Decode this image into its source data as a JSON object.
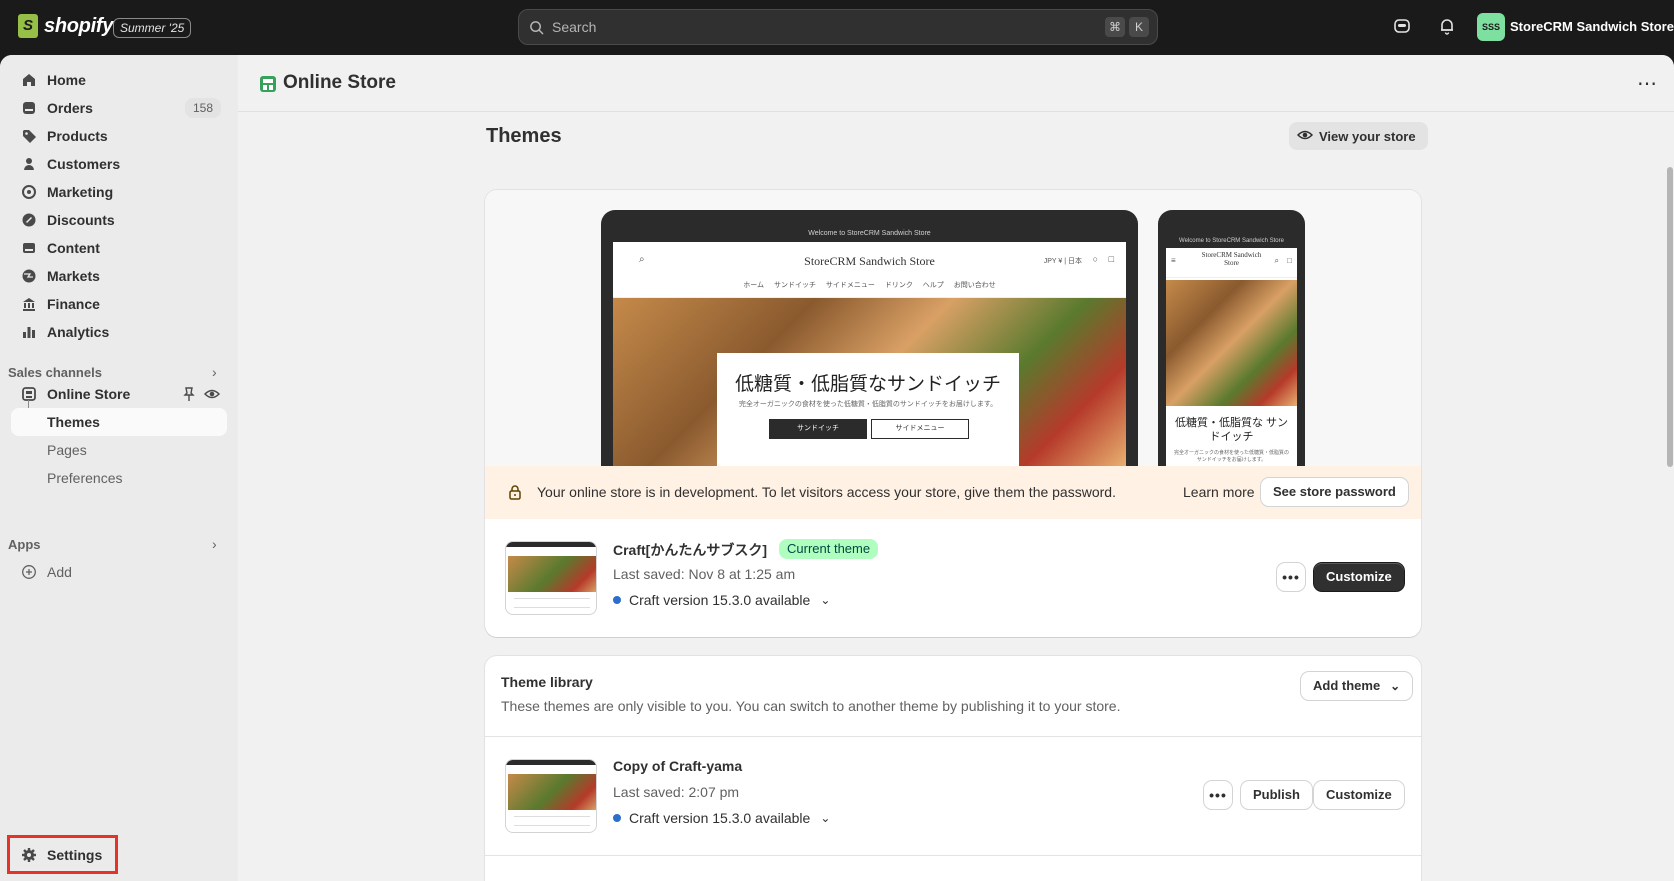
{
  "topbar": {
    "logo_text": "shopify",
    "edition_badge": "Summer '25",
    "search_placeholder": "Search",
    "shortcut_cmd": "⌘",
    "shortcut_key": "K",
    "store_initials": "SSS",
    "store_name": "StoreCRM Sandwich Store"
  },
  "sidebar": {
    "items": [
      {
        "label": "Home",
        "icon": "home-icon"
      },
      {
        "label": "Orders",
        "icon": "orders-icon",
        "count": "158"
      },
      {
        "label": "Products",
        "icon": "tag-icon"
      },
      {
        "label": "Customers",
        "icon": "person-icon"
      },
      {
        "label": "Marketing",
        "icon": "target-icon"
      },
      {
        "label": "Discounts",
        "icon": "discount-icon"
      },
      {
        "label": "Content",
        "icon": "content-icon"
      },
      {
        "label": "Markets",
        "icon": "globe-icon"
      },
      {
        "label": "Finance",
        "icon": "bank-icon"
      },
      {
        "label": "Analytics",
        "icon": "bar-chart-icon"
      }
    ],
    "sales_channels_label": "Sales channels",
    "online_store_label": "Online Store",
    "sub_items": [
      "Themes",
      "Pages",
      "Preferences"
    ],
    "apps_label": "Apps",
    "add_label": "Add",
    "settings_label": "Settings"
  },
  "page": {
    "title": "Online Store",
    "section_title": "Themes",
    "view_store_label": "View your store"
  },
  "preview": {
    "announcement": "Welcome to StoreCRM Sandwich Store",
    "store_title": "StoreCRM Sandwich Store",
    "currency": "JPY ¥ | 日本",
    "menu": "ホーム サンドイッチ サイドメニュー ドリンク ヘルプ お問い合わせ",
    "hero_title": "低糖質・低脂質なサンドイッチ",
    "hero_sub": "完全オーガニックの食材を使った低糖質・低脂質のサンドイッチをお届けします。",
    "hero_btn_primary": "サンドイッチ",
    "hero_btn_secondary": "サイドメニュー",
    "phone_store_title": "StoreCRM Sandwich Store",
    "phone_hero_title": "低糖質・低脂質な サンドイッチ",
    "phone_hero_sub": "完全オーガニックの食材を使った低糖質・低脂質のサンドイッチをお届けします。"
  },
  "dev_banner": {
    "text": "Your online store is in development. To let visitors access your store, give them the password.",
    "learn_more": "Learn more",
    "button": "See store password"
  },
  "current_theme": {
    "name": "Craft[かんたんサブスク]",
    "badge": "Current theme",
    "last_saved": "Last saved: Nov 8 at 1:25 am",
    "version": "Craft version 15.3.0 available",
    "customize_label": "Customize",
    "more_label": "•••"
  },
  "library": {
    "title": "Theme library",
    "description": "These themes are only visible to you. You can switch to another theme by publishing it to your store.",
    "add_theme_label": "Add theme",
    "themes": [
      {
        "name": "Copy of Craft-yama",
        "last_saved": "Last saved: 2:07 pm",
        "version": "Craft version 15.3.0 available",
        "publish_label": "Publish",
        "customize_label": "Customize",
        "more_label": "•••"
      }
    ]
  },
  "colors": {
    "topbar_bg": "#1a1a1a",
    "accent_green": "#affebf",
    "primary_button": "#303030",
    "dev_banner_bg": "#fff1e3",
    "settings_highlight": "#e5332a"
  }
}
